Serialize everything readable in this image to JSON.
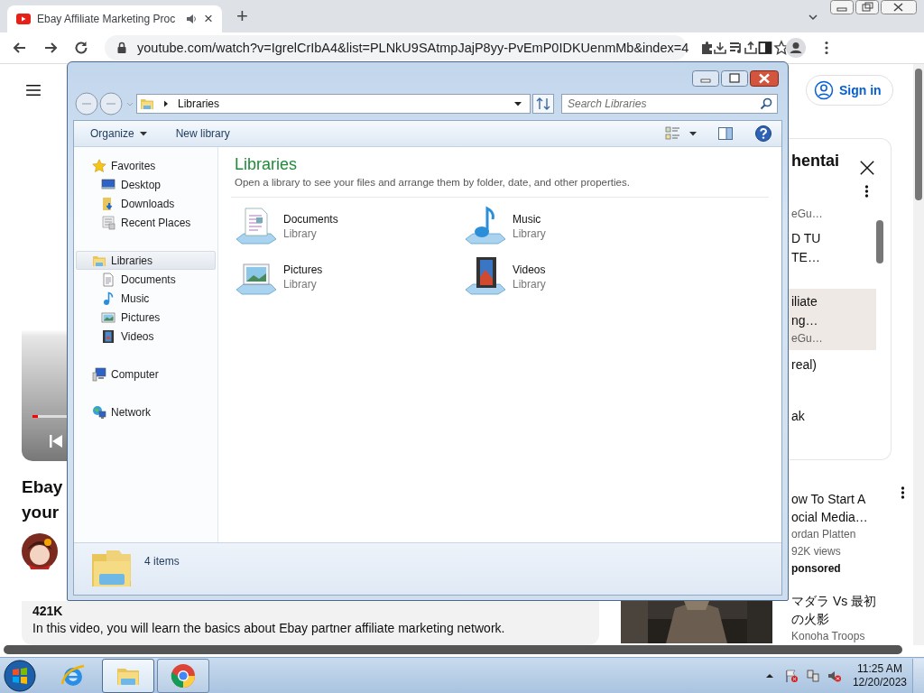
{
  "browser": {
    "tab": {
      "title": "Ebay Affiliate Marketing Proc",
      "close": "×"
    },
    "new_tab": "+",
    "url": "youtube.com/watch?v=IgrelCrIbA4&list=PLNkU9SAtmpJajP8yy-PvEmP0IDKUenmMb&index=4"
  },
  "page": {
    "sign_in": "Sign in",
    "video_title_lines": [
      "Ebay",
      "your"
    ],
    "views": "421K",
    "description": "In this video, you will learn the basics about Ebay partner affiliate marketing network.",
    "playlist": {
      "title": "hentai",
      "rows": [
        {
          "title_lines": [],
          "channel": "eGu…",
          "selected": false
        },
        {
          "title_lines": [
            "D TU",
            "TE…"
          ],
          "selected": false
        },
        {
          "title_lines": [
            "iliate",
            "ng…"
          ],
          "channel": "eGu…",
          "selected": true
        },
        {
          "title_lines": [
            "real)"
          ],
          "selected": false
        },
        {
          "title_lines": [
            "ak"
          ],
          "selected": false
        }
      ]
    },
    "suggestions": [
      {
        "title_lines": [
          "ow To Start A",
          "ocial Media…"
        ],
        "channel": "ordan Platten",
        "views": "92K views",
        "sponsored": "ponsored"
      },
      {
        "title_lines": [
          "マダラ Vs 最初",
          "の火影"
        ],
        "channel": "Konoha Troops",
        "kind": "picture"
      }
    ]
  },
  "explorer": {
    "address": "Libraries",
    "search_placeholder": "Search Libraries",
    "toolbar": [
      {
        "label": "Organize",
        "menu": true
      },
      {
        "label": "New library",
        "menu": false
      }
    ],
    "nav": [
      {
        "label": "Favorites",
        "selected": false,
        "children": [
          {
            "label": "Desktop",
            "selected": false
          },
          {
            "label": "Downloads",
            "selected": false
          },
          {
            "label": "Recent Places",
            "selected": false
          }
        ]
      },
      {
        "label": "Libraries",
        "selected": true,
        "children": [
          {
            "label": "Documents",
            "selected": false
          },
          {
            "label": "Music",
            "selected": false
          },
          {
            "label": "Pictures",
            "selected": false
          },
          {
            "label": "Videos",
            "selected": false
          }
        ]
      },
      {
        "label": "Computer",
        "selected": false
      },
      {
        "label": "Network",
        "selected": false
      }
    ],
    "heading": "Libraries",
    "subtitle": "Open a library to see your files and arrange them by folder, date, and other properties.",
    "libraries": [
      {
        "name": "Documents",
        "type": "Library"
      },
      {
        "name": "Music",
        "type": "Library"
      },
      {
        "name": "Pictures",
        "type": "Library"
      },
      {
        "name": "Videos",
        "type": "Library"
      }
    ],
    "status": "4 items"
  },
  "taskbar": {
    "apps": [
      {
        "kind": "ie",
        "running": false,
        "selected": false
      },
      {
        "kind": "explorer",
        "running": true,
        "selected": true
      },
      {
        "kind": "chrome",
        "running": true,
        "selected": false
      }
    ],
    "time": "11:25 AM",
    "date": "12/20/2023"
  }
}
